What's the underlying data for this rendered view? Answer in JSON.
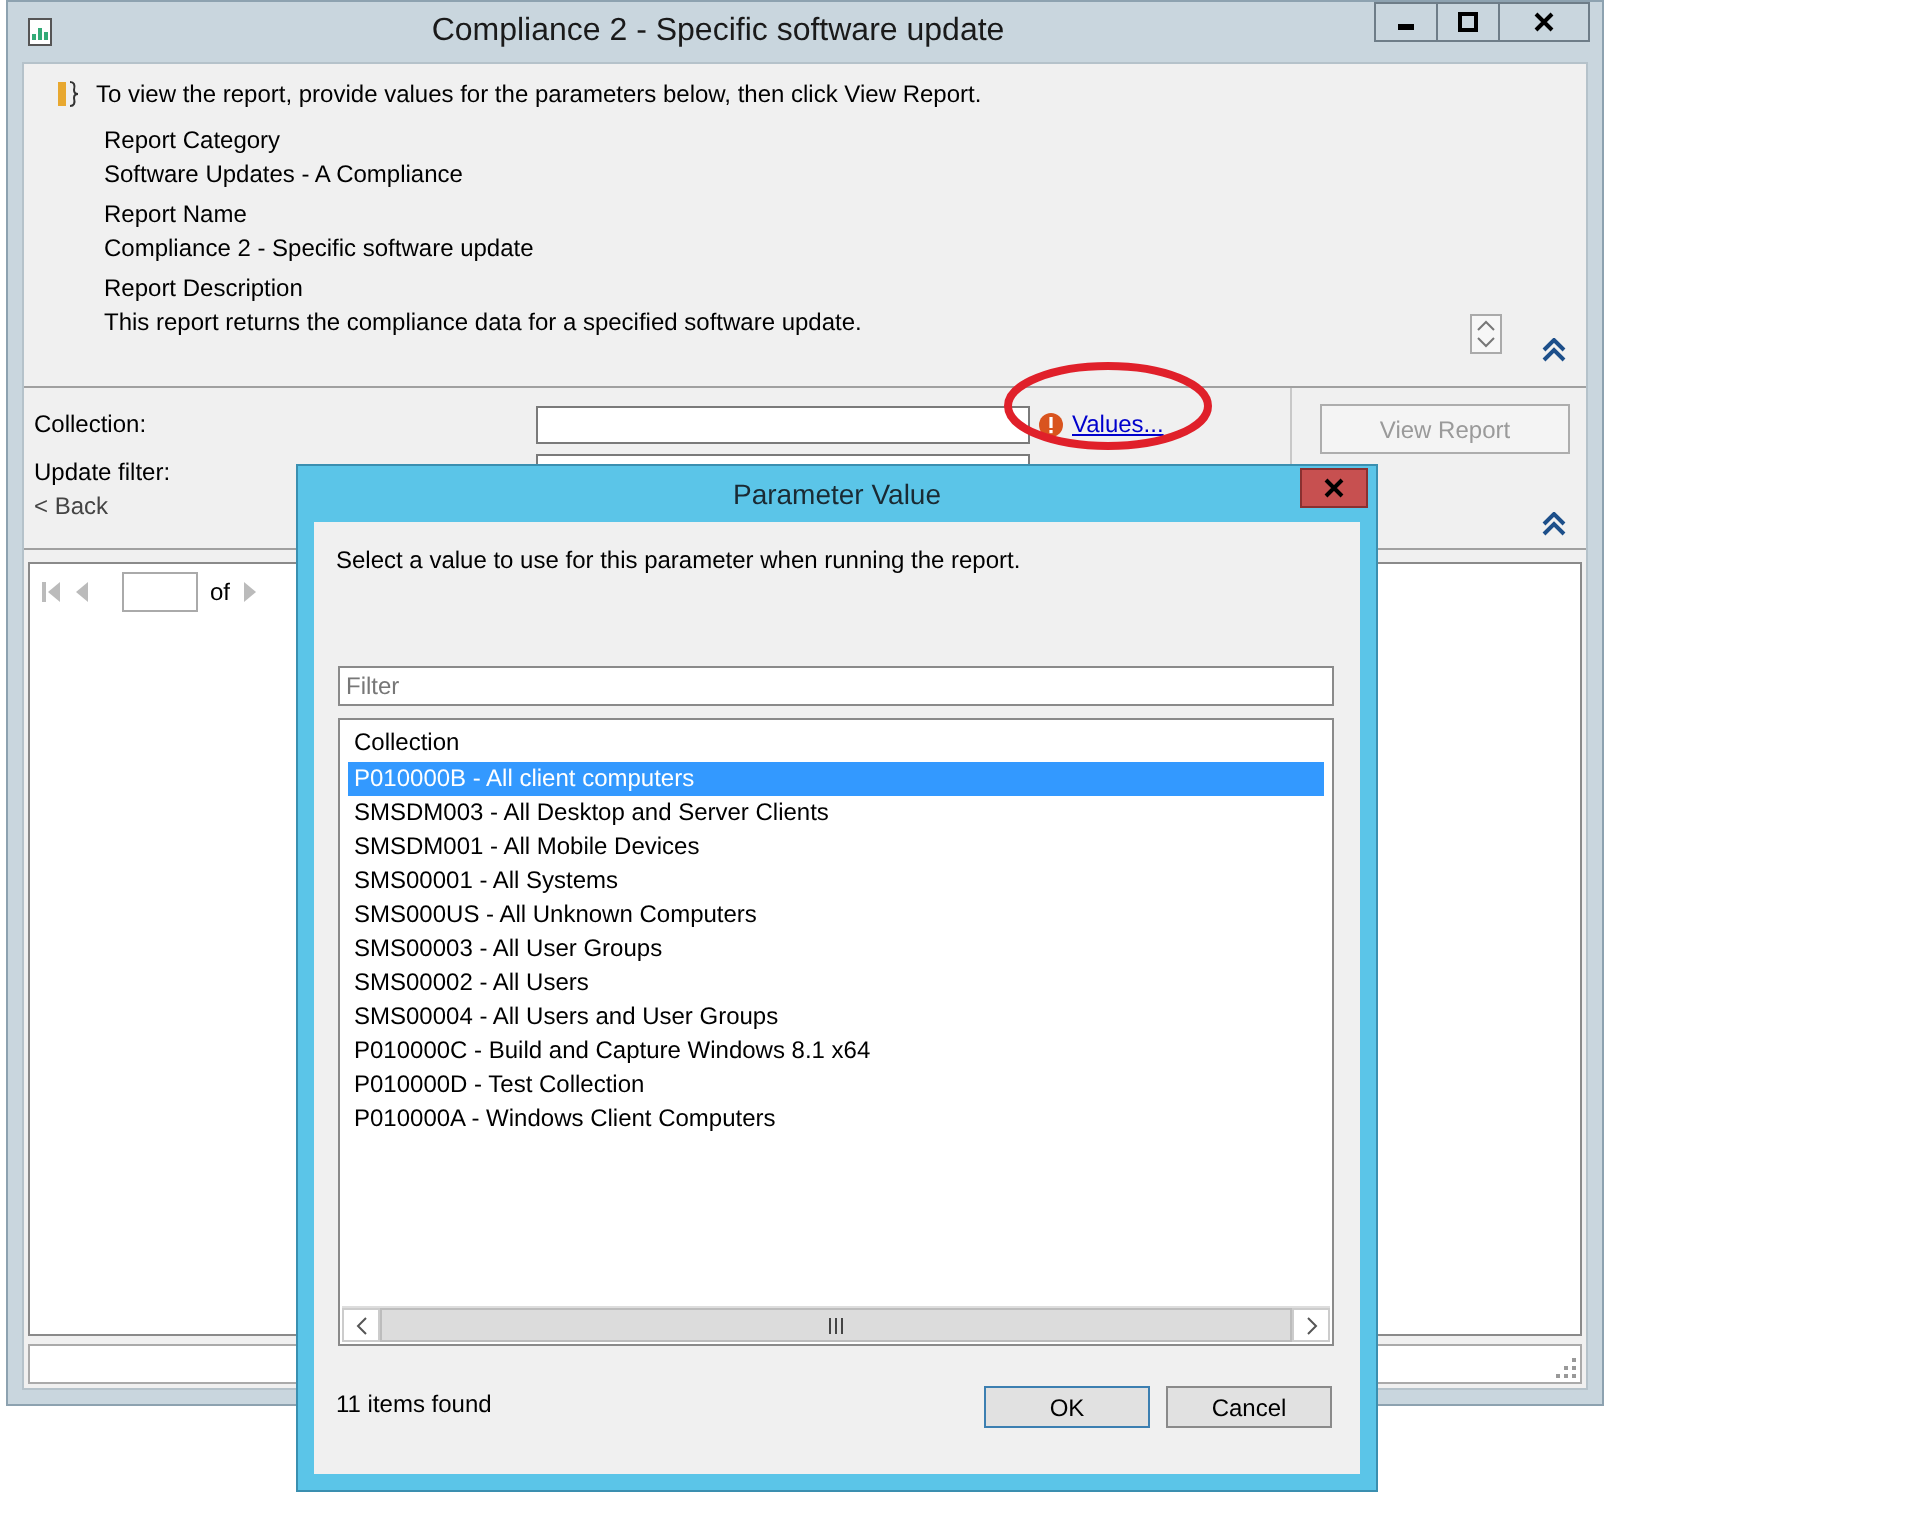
{
  "window": {
    "title": "Compliance 2 - Specific software update"
  },
  "info": {
    "message": "To view the report, provide values for the parameters below, then click View Report."
  },
  "report_details": [
    {
      "label": "Report Category",
      "value": "Software Updates - A Compliance"
    },
    {
      "label": "Report Name",
      "value": "Compliance 2 - Specific software update"
    },
    {
      "label": "Report Description",
      "value": "This report returns the compliance data for a specified software update."
    }
  ],
  "parameters": [
    {
      "label": "Collection:",
      "warning": true,
      "link": "Values..."
    },
    {
      "label": "Update filter:"
    }
  ],
  "back_link": "< Back",
  "view_report_button": {
    "label": "View Report",
    "disabled": true
  },
  "report_toolbar": {
    "page_of": "of"
  },
  "dialog": {
    "title": "Parameter Value",
    "instruction": "Select a value to use for this parameter when running the report.",
    "filter": {
      "placeholder": "Filter"
    },
    "list": {
      "column": "Collection",
      "items": [
        {
          "label": "P010000B - All client computers",
          "selected": true
        },
        {
          "label": "SMSDM003 - All Desktop and Server Clients",
          "selected": false
        },
        {
          "label": "SMSDM001 - All Mobile Devices",
          "selected": false
        },
        {
          "label": "SMS00001 - All Systems",
          "selected": false
        },
        {
          "label": "SMS000US - All Unknown Computers",
          "selected": false
        },
        {
          "label": "SMS00003 - All User Groups",
          "selected": false
        },
        {
          "label": "SMS00002 - All Users",
          "selected": false
        },
        {
          "label": "SMS00004 - All Users and User Groups",
          "selected": false
        },
        {
          "label": "P010000C - Build and Capture Windows 8.1 x64",
          "selected": false
        },
        {
          "label": "P010000D - Test Collection",
          "selected": false
        },
        {
          "label": "P010000A - Windows Client Computers",
          "selected": false
        }
      ]
    },
    "status": "11 items found",
    "buttons": [
      "OK",
      "Cancel"
    ]
  }
}
